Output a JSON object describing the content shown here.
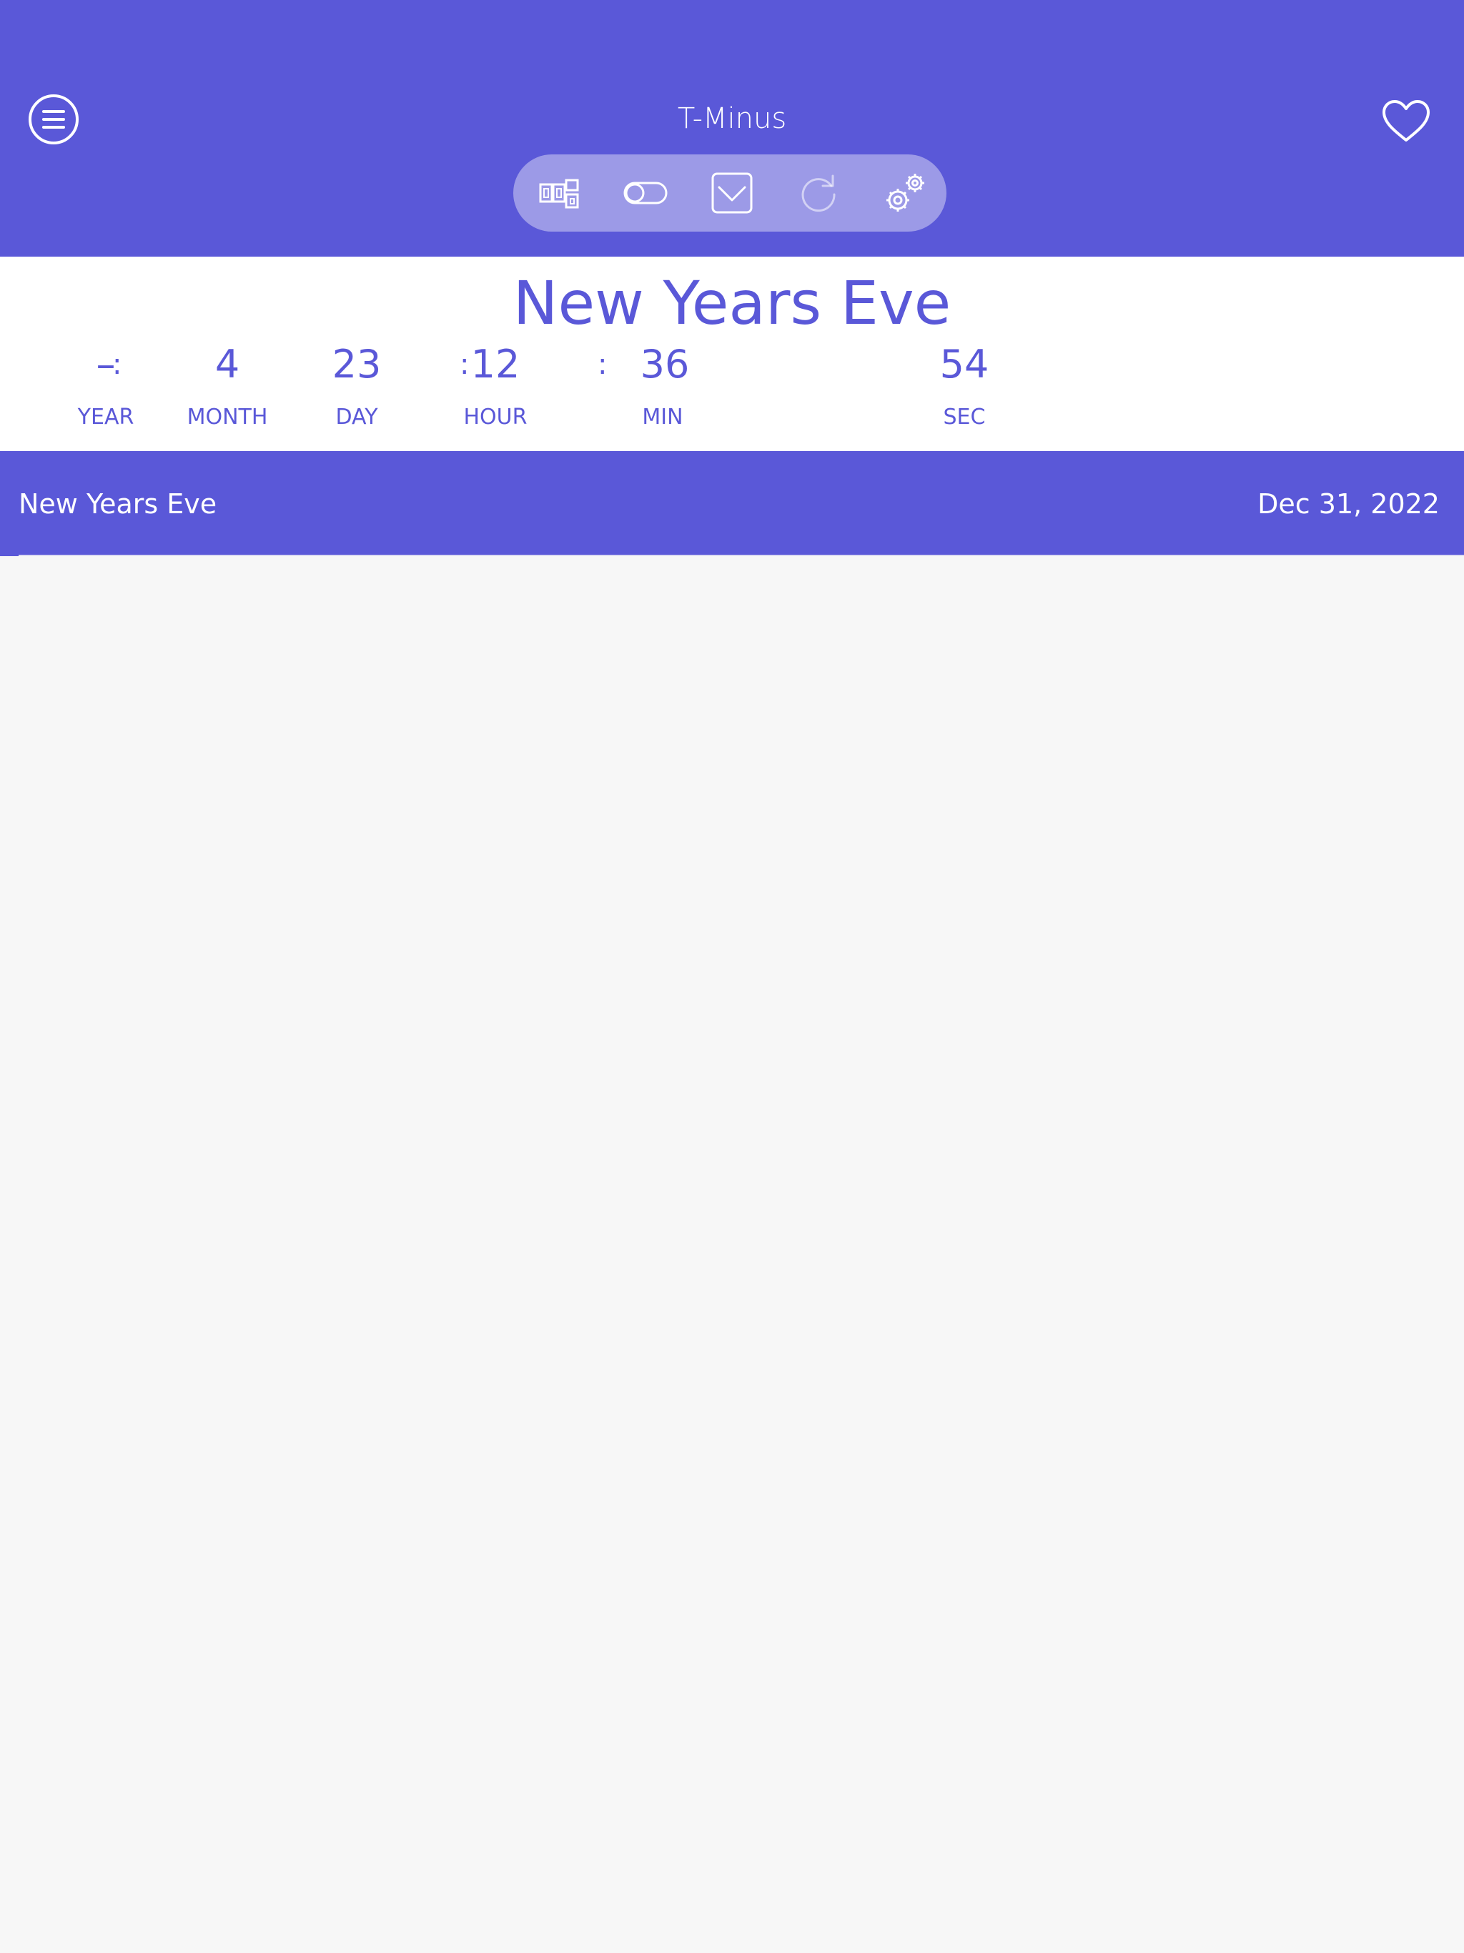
{
  "app": {
    "title": "T-Minus"
  },
  "colors": {
    "accent": "#5a58d8",
    "background": "#f7f7f7",
    "panel": "#ffffff"
  },
  "toolbar": {
    "tools": [
      {
        "name": "timer-style-icon"
      },
      {
        "name": "toggle-icon"
      },
      {
        "name": "dropdown-icon"
      },
      {
        "name": "refresh-icon",
        "disabled": true
      },
      {
        "name": "settings-icon"
      }
    ]
  },
  "countdown": {
    "event_name": "New Years Eve",
    "year": "–",
    "month": "4",
    "day": "23",
    "hour": "12",
    "min": "36",
    "sec": "54",
    "labels": {
      "year": "YEAR",
      "month": "MONTH",
      "day": "DAY",
      "hour": "HOUR",
      "min": "MIN",
      "sec": "SEC"
    },
    "separator": ":"
  },
  "events": [
    {
      "name": "New Years Eve",
      "date": "Dec 31, 2022"
    }
  ]
}
